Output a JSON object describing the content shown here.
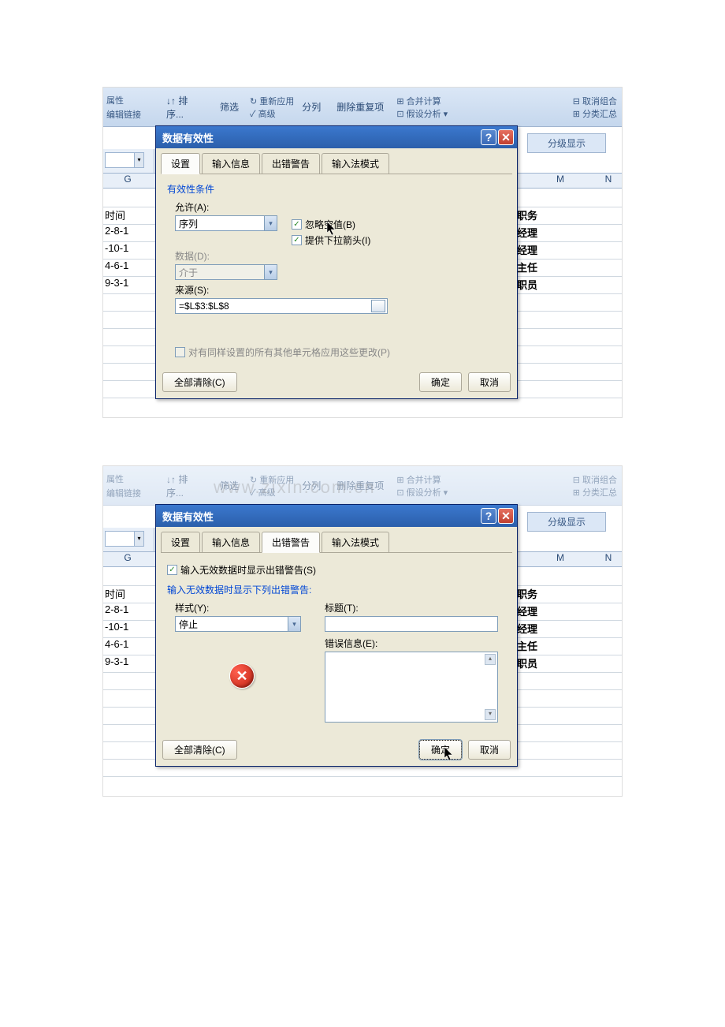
{
  "ribbon": {
    "properties": "属性",
    "edit_links": "编辑链接",
    "sort": "排序...",
    "filter": "筛选",
    "reapply": "重新应用",
    "advanced": "高级",
    "text_to_cols": "分列",
    "remove_dup": "删除重复项",
    "recalc": "合并计算",
    "what_if": "假设分析",
    "ungroup": "取消组合",
    "subtotal": "分类汇总",
    "outline_label": "分级显示"
  },
  "columns": {
    "g": "G",
    "m": "M",
    "n": "N"
  },
  "rows": {
    "left": [
      "时间",
      "2-8-1",
      "-10-1",
      "4-6-1",
      "9-3-1"
    ],
    "right": [
      "职务",
      "经理",
      "经理",
      "主任",
      "职员"
    ]
  },
  "dialog1": {
    "title": "数据有效性",
    "tabs": [
      "设置",
      "输入信息",
      "出错警告",
      "输入法模式"
    ],
    "fieldset": "有效性条件",
    "allow_label": "允许(A):",
    "allow_value": "序列",
    "data_label": "数据(D):",
    "data_value": "介于",
    "source_label": "来源(S):",
    "source_value": "=$L$3:$L$8",
    "ignore_blank": "忽略空值(B)",
    "dropdown_arrow": "提供下拉箭头(I)",
    "apply_all": "对有同样设置的所有其他单元格应用这些更改(P)",
    "clear_all": "全部清除(C)",
    "ok": "确定",
    "cancel": "取消"
  },
  "dialog2": {
    "title": "数据有效性",
    "tabs": [
      "设置",
      "输入信息",
      "出错警告",
      "输入法模式"
    ],
    "show_alert": "输入无效数据时显示出错警告(S)",
    "fieldset": "输入无效数据时显示下列出错警告:",
    "style_label": "样式(Y):",
    "style_value": "停止",
    "title_label": "标题(T):",
    "message_label": "错误信息(E):",
    "clear_all": "全部清除(C)",
    "ok": "确定",
    "cancel": "取消"
  },
  "watermark": "www.zixin.com.cn"
}
